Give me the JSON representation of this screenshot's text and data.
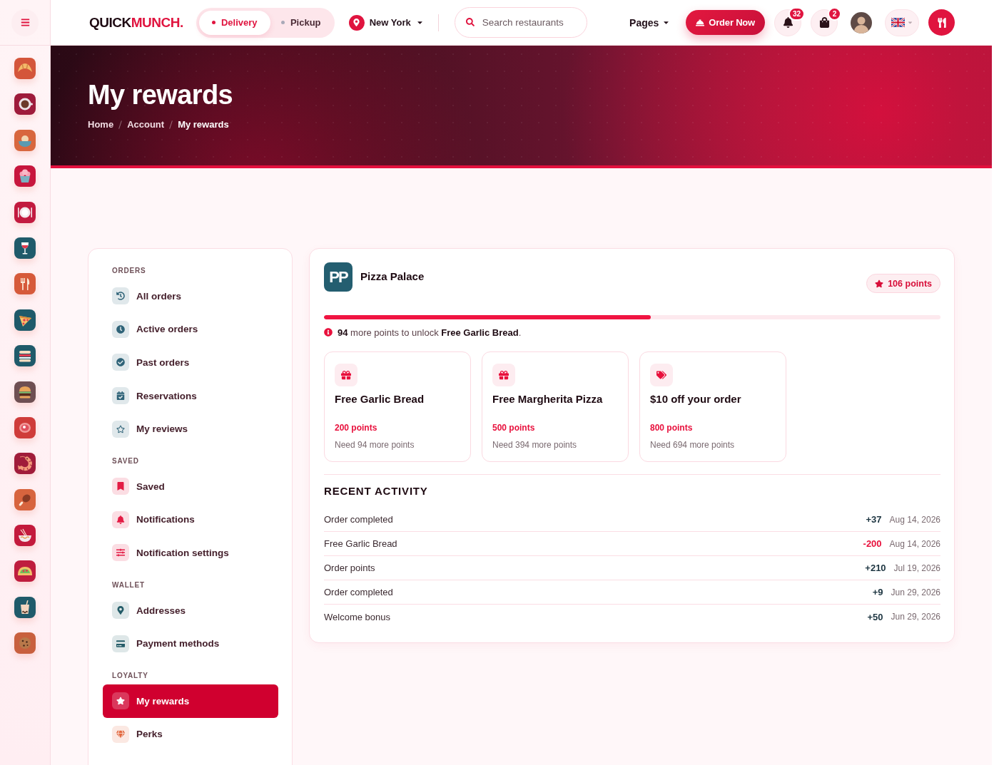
{
  "category_rail": [
    {
      "color": "#d4553a"
    },
    {
      "color": "#9e1b3b"
    },
    {
      "color": "#d8673e"
    },
    {
      "color": "#c7163d"
    },
    {
      "color": "#c21a3f"
    },
    {
      "color": "#1f5a6a"
    },
    {
      "color": "#d65a3a"
    },
    {
      "color": "#1f5a6a"
    },
    {
      "color": "#1f5a6a"
    },
    {
      "color": "#6e4f52"
    },
    {
      "color": "#cf3c3a"
    },
    {
      "color": "#a01c3a"
    },
    {
      "color": "#d7643e"
    },
    {
      "color": "#c31a3c"
    },
    {
      "color": "#bf1d3e"
    },
    {
      "color": "#1f5a6a"
    },
    {
      "color": "#c8603e"
    }
  ],
  "header": {
    "logo": {
      "word": "QUICK",
      "accent": "MUNCH."
    },
    "modes": [
      {
        "label": "Delivery",
        "selected": true
      },
      {
        "label": "Pickup",
        "selected": false
      }
    ],
    "location": "New York",
    "search": {
      "placeholder": "Search restaurants"
    },
    "pages_menu": "Pages",
    "order_button": "Order Now",
    "notifications": {
      "count": "32"
    },
    "cart": {
      "count": "2"
    }
  },
  "hero": {
    "title": "My rewards",
    "breadcrumb": [
      "Home",
      "Account",
      "My rewards"
    ]
  },
  "account_menu": [
    {
      "title": "ORDERS",
      "color": "#2f6378",
      "items": [
        {
          "label": "All orders",
          "selected": false
        },
        {
          "label": "Active orders",
          "selected": false
        },
        {
          "label": "Past orders",
          "selected": false
        },
        {
          "label": "Reservations",
          "selected": false
        },
        {
          "label": "My reviews",
          "selected": false
        }
      ]
    },
    {
      "title": "SAVED",
      "color": "#e31b44",
      "items": [
        {
          "label": "Saved",
          "selected": false
        },
        {
          "label": "Notifications",
          "selected": false
        },
        {
          "label": "Notification settings",
          "selected": false
        }
      ]
    },
    {
      "title": "WALLET",
      "color": "#245c68",
      "items": [
        {
          "label": "Addresses",
          "selected": false
        },
        {
          "label": "Payment methods",
          "selected": false
        }
      ]
    },
    {
      "title": "LOYALTY",
      "color": "#e2683f",
      "items": [
        {
          "label": "My rewards",
          "selected": true
        },
        {
          "label": "Perks",
          "selected": false
        }
      ]
    }
  ],
  "rewards_card": {
    "restaurant": {
      "initials": "PP",
      "name": "Pizza Palace"
    },
    "points_badge": "106 points",
    "progress": {
      "level": 0.53
    },
    "progress_note": "**94** more points to unlock **Free Garlic Bread**.",
    "rewards": [
      {
        "kind": "gift",
        "title": "Free Garlic Bread",
        "cost": "200 points",
        "need": "Need 94 more points"
      },
      {
        "kind": "gift",
        "title": "Free Margherita Pizza",
        "cost": "500 points",
        "need": "Need 394 more points"
      },
      {
        "kind": "tag",
        "title": "$10 off your order",
        "cost": "800 points",
        "need": "Need 694 more points"
      }
    ],
    "activity": {
      "title": "RECENT ACTIVITY",
      "rows": [
        {
          "label": "Order completed",
          "points": "+37",
          "kind": "credit",
          "date": "Aug 14, 2026"
        },
        {
          "label": "Free Garlic Bread",
          "points": "-200",
          "kind": "debit",
          "date": "Aug 14, 2026"
        },
        {
          "label": "Order points",
          "points": "+210",
          "kind": "credit",
          "date": "Jul 19, 2026"
        },
        {
          "label": "Order completed",
          "points": "+9",
          "kind": "credit",
          "date": "Jun 29, 2026"
        },
        {
          "label": "Welcome bonus",
          "points": "+50",
          "kind": "credit",
          "date": "Jun 29, 2026"
        }
      ]
    }
  }
}
